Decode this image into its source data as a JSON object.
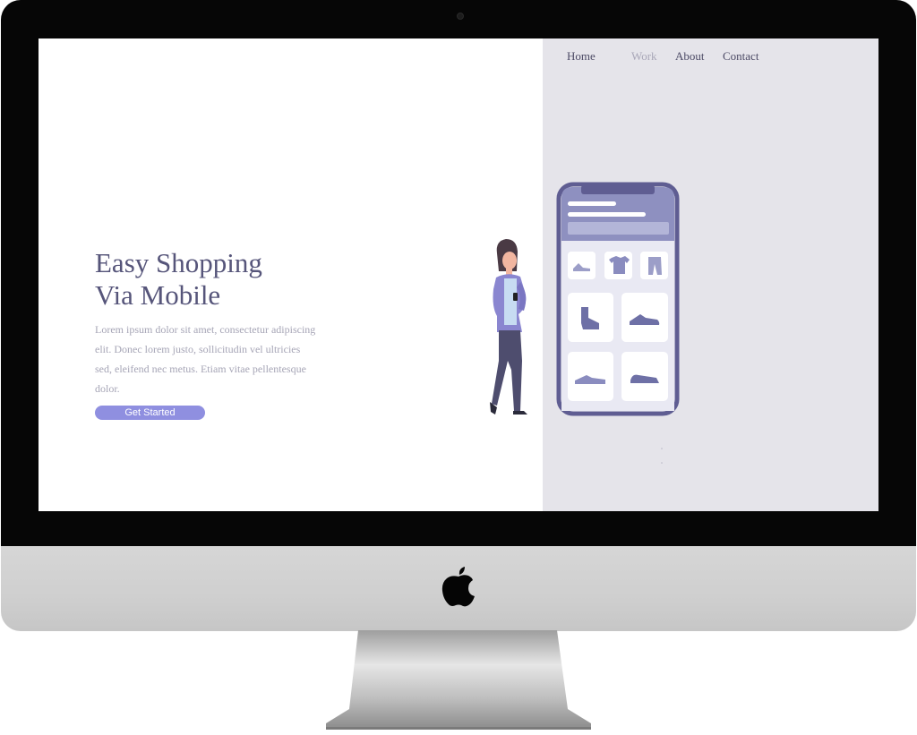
{
  "nav": {
    "items": [
      {
        "label": "Home"
      },
      {
        "label": "Work"
      },
      {
        "label": "About"
      },
      {
        "label": "Contact"
      }
    ]
  },
  "hero": {
    "title": "Easy Shopping\nVia Mobile",
    "text": "Lorem ipsum dolor sit amet, consectetur adipiscing elit. Donec lorem justo, sollicitudin vel ultricies sed, eleifend nec metus. Etiam vitae pellentesque dolor.",
    "cta_label": "Get Started"
  },
  "colors": {
    "accent": "#8f8fe0",
    "heading": "#56557a",
    "panel": "#e5e4ea",
    "phone": "#5f5d92"
  },
  "icons": [
    "apple-logo-icon",
    "sneaker-icon",
    "tshirt-icon",
    "pants-icon",
    "boot-icon",
    "shoe-icon"
  ]
}
